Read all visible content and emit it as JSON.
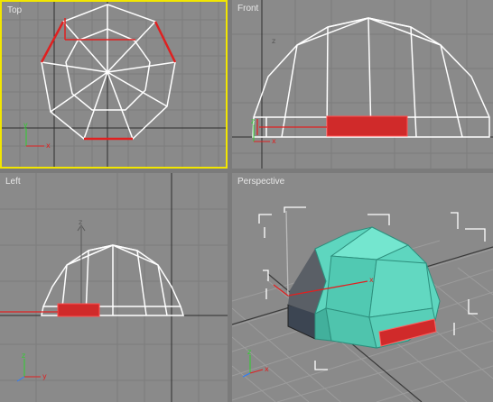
{
  "viewports": {
    "top": {
      "label": "Top"
    },
    "front": {
      "label": "Front"
    },
    "left": {
      "label": "Left"
    },
    "perspective": {
      "label": "Perspective"
    }
  },
  "axis_letters": {
    "x": "x",
    "y": "y",
    "z": "z"
  },
  "colors": {
    "viewport_bg": "#8a8a8a",
    "grid": "#7c7c7c",
    "wire": "#ffffff",
    "selected": "#e02020",
    "active_border": "#f2e600",
    "dome": "#5ed6bf",
    "dome_dark": "#3c4552",
    "gap": "#7b7b7b"
  }
}
